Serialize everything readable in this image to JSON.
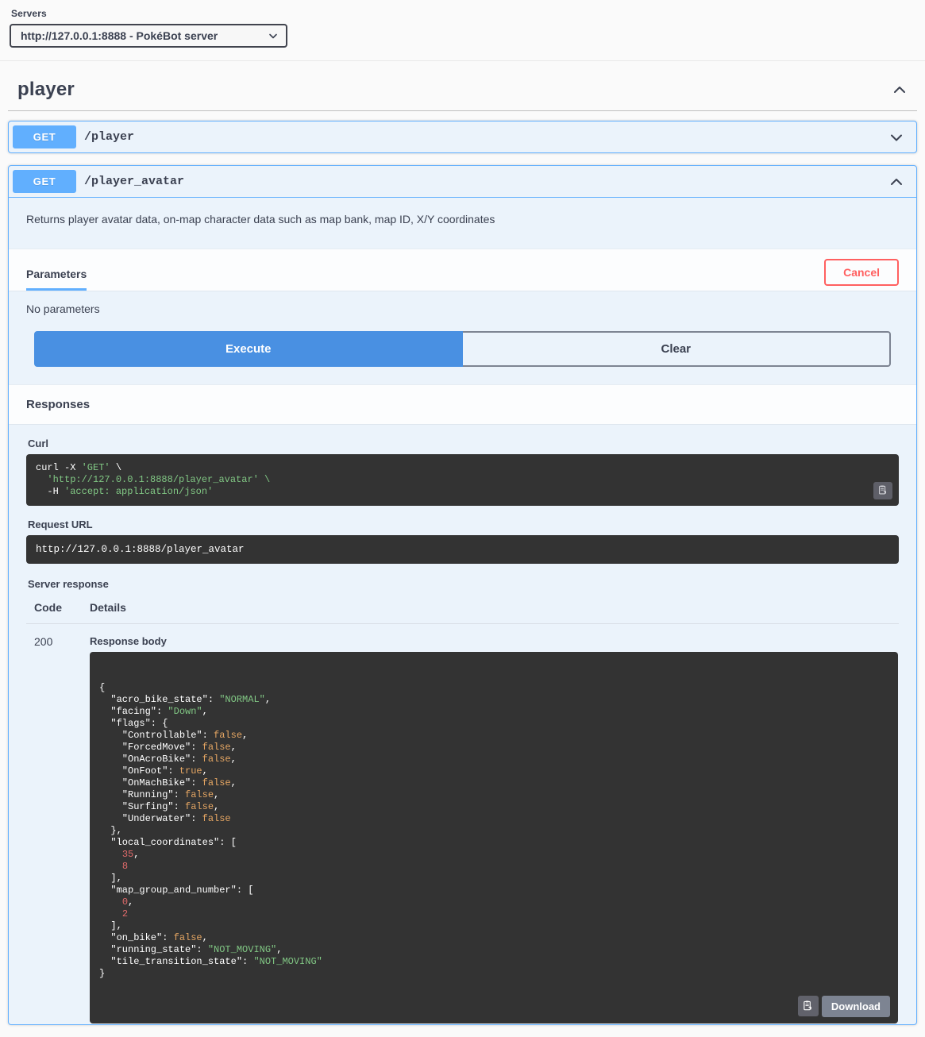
{
  "servers": {
    "label": "Servers",
    "selected": "http://127.0.0.1:8888 - PokéBot server",
    "options": [
      "http://127.0.0.1:8888 - PokéBot server"
    ]
  },
  "tag": {
    "title": "player",
    "expanded": true
  },
  "operations": [
    {
      "method": "GET",
      "path": "/player",
      "expanded": false
    },
    {
      "method": "GET",
      "path": "/player_avatar",
      "expanded": true,
      "description": "Returns player avatar data, on-map character data such as map bank, map ID, X/Y coordinates",
      "parameters_tab": "Parameters",
      "cancel_label": "Cancel",
      "no_parameters_text": "No parameters",
      "execute_label": "Execute",
      "clear_label": "Clear",
      "responses_title": "Responses",
      "curl_label": "Curl",
      "curl": {
        "line1_cmd": "curl -X ",
        "line1_str": "'GET'",
        "line1_tail": " \\",
        "line2": "  'http://127.0.0.1:8888/player_avatar' \\",
        "line3_flag": "  -H ",
        "line3_str": "'accept: application/json'"
      },
      "request_url_label": "Request URL",
      "request_url": "http://127.0.0.1:8888/player_avatar",
      "server_response_label": "Server response",
      "table_headers": {
        "code": "Code",
        "details": "Details"
      },
      "response": {
        "code": "200",
        "body_label": "Response body",
        "download_label": "Download",
        "json_lines": [
          [
            {
              "t": "{",
              "c": "p"
            }
          ],
          [
            {
              "t": "  \"acro_bike_state\": ",
              "c": "k"
            },
            {
              "t": "\"NORMAL\"",
              "c": "s"
            },
            {
              "t": ",",
              "c": "p"
            }
          ],
          [
            {
              "t": "  \"facing\": ",
              "c": "k"
            },
            {
              "t": "\"Down\"",
              "c": "s"
            },
            {
              "t": ",",
              "c": "p"
            }
          ],
          [
            {
              "t": "  \"flags\": {",
              "c": "k"
            }
          ],
          [
            {
              "t": "    \"Controllable\": ",
              "c": "k"
            },
            {
              "t": "false",
              "c": "b"
            },
            {
              "t": ",",
              "c": "p"
            }
          ],
          [
            {
              "t": "    \"ForcedMove\": ",
              "c": "k"
            },
            {
              "t": "false",
              "c": "b"
            },
            {
              "t": ",",
              "c": "p"
            }
          ],
          [
            {
              "t": "    \"OnAcroBike\": ",
              "c": "k"
            },
            {
              "t": "false",
              "c": "b"
            },
            {
              "t": ",",
              "c": "p"
            }
          ],
          [
            {
              "t": "    \"OnFoot\": ",
              "c": "k"
            },
            {
              "t": "true",
              "c": "b"
            },
            {
              "t": ",",
              "c": "p"
            }
          ],
          [
            {
              "t": "    \"OnMachBike\": ",
              "c": "k"
            },
            {
              "t": "false",
              "c": "b"
            },
            {
              "t": ",",
              "c": "p"
            }
          ],
          [
            {
              "t": "    \"Running\": ",
              "c": "k"
            },
            {
              "t": "false",
              "c": "b"
            },
            {
              "t": ",",
              "c": "p"
            }
          ],
          [
            {
              "t": "    \"Surfing\": ",
              "c": "k"
            },
            {
              "t": "false",
              "c": "b"
            },
            {
              "t": ",",
              "c": "p"
            }
          ],
          [
            {
              "t": "    \"Underwater\": ",
              "c": "k"
            },
            {
              "t": "false",
              "c": "b"
            }
          ],
          [
            {
              "t": "  },",
              "c": "p"
            }
          ],
          [
            {
              "t": "  \"local_coordinates\": [",
              "c": "k"
            }
          ],
          [
            {
              "t": "    ",
              "c": "p"
            },
            {
              "t": "35",
              "c": "n"
            },
            {
              "t": ",",
              "c": "p"
            }
          ],
          [
            {
              "t": "    ",
              "c": "p"
            },
            {
              "t": "8",
              "c": "n"
            }
          ],
          [
            {
              "t": "  ],",
              "c": "p"
            }
          ],
          [
            {
              "t": "  \"map_group_and_number\": [",
              "c": "k"
            }
          ],
          [
            {
              "t": "    ",
              "c": "p"
            },
            {
              "t": "0",
              "c": "n"
            },
            {
              "t": ",",
              "c": "p"
            }
          ],
          [
            {
              "t": "    ",
              "c": "p"
            },
            {
              "t": "2",
              "c": "n"
            }
          ],
          [
            {
              "t": "  ],",
              "c": "p"
            }
          ],
          [
            {
              "t": "  \"on_bike\": ",
              "c": "k"
            },
            {
              "t": "false",
              "c": "b"
            },
            {
              "t": ",",
              "c": "p"
            }
          ],
          [
            {
              "t": "  \"running_state\": ",
              "c": "k"
            },
            {
              "t": "\"NOT_MOVING\"",
              "c": "s"
            },
            {
              "t": ",",
              "c": "p"
            }
          ],
          [
            {
              "t": "  \"tile_transition_state\": ",
              "c": "k"
            },
            {
              "t": "\"NOT_MOVING\"",
              "c": "s"
            }
          ],
          [
            {
              "t": "}",
              "c": "p"
            }
          ]
        ]
      }
    }
  ],
  "icons": {
    "chevron_up": "chevron-up-icon",
    "chevron_down": "chevron-down-icon",
    "copy": "copy-icon",
    "caret": "caret-down-icon"
  },
  "colors": {
    "get_method": "#61affe",
    "execute": "#4990e2",
    "cancel": "#ff6060",
    "code_bg": "#333333",
    "string": "#81c784",
    "boolean": "#e5a663",
    "number": "#e06b6b"
  }
}
